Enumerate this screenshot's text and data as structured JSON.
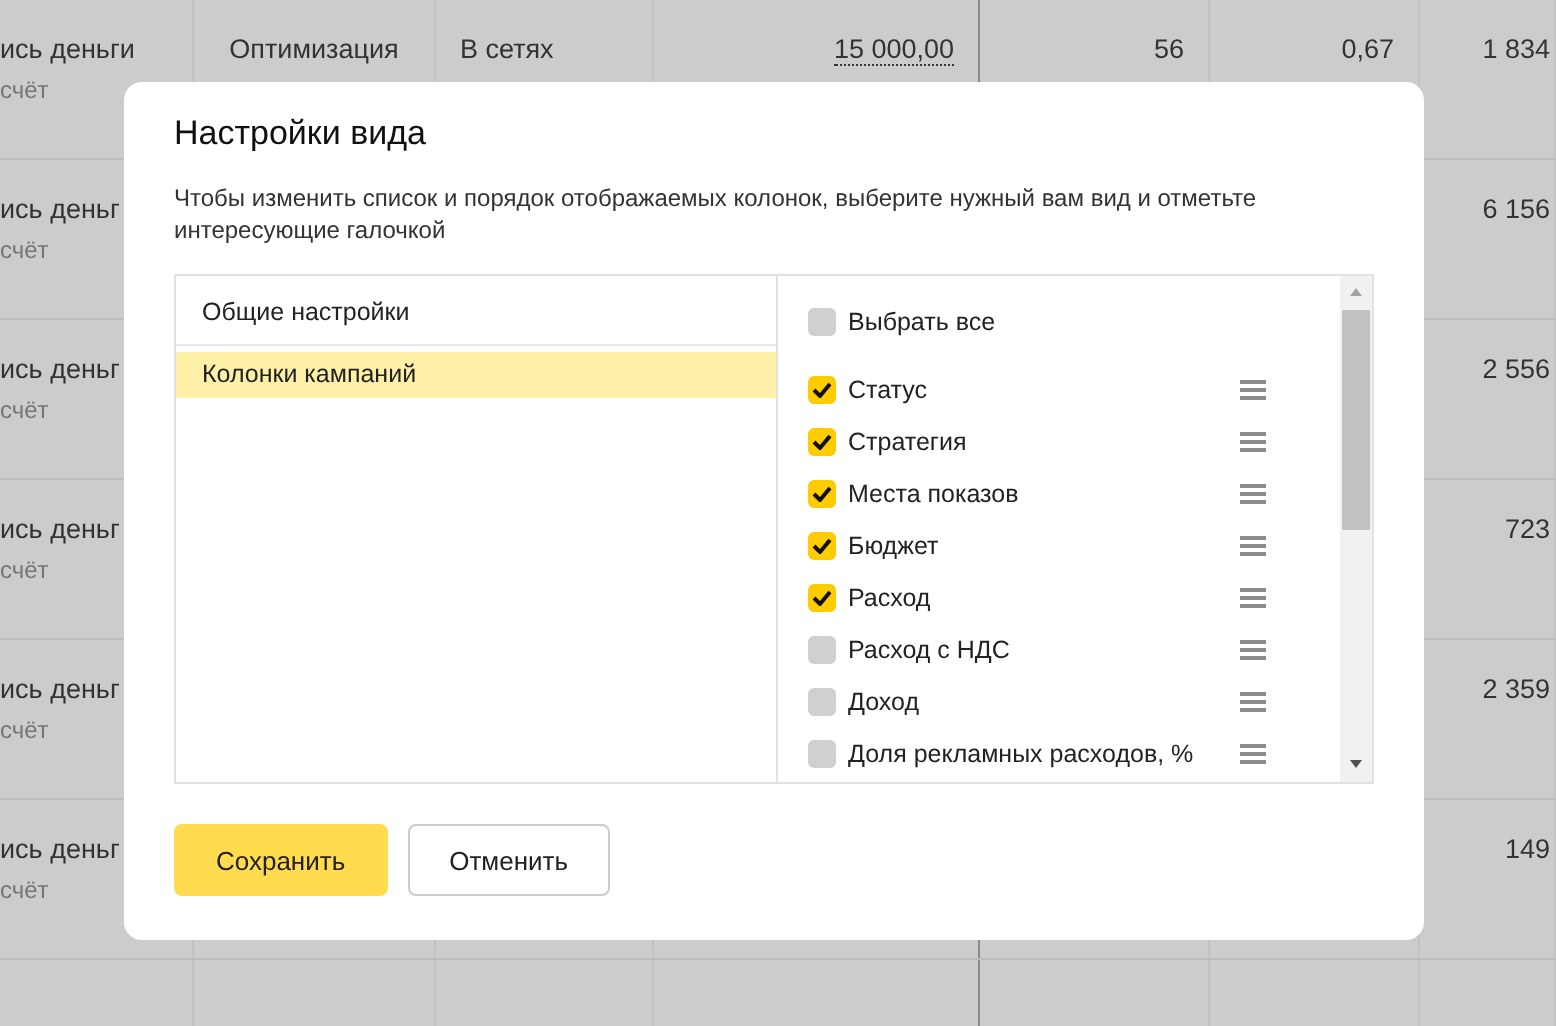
{
  "table": {
    "rows": [
      {
        "name": "ись деньги",
        "note": "счёт",
        "column_2": "Оптимизация",
        "column_3": "В сетях",
        "column_4": "15 000,00",
        "column_5": "56",
        "column_6": "0,67",
        "column_7": "1 834"
      },
      {
        "name": "ись деньг",
        "note": "счёт",
        "column_7": "6 156"
      },
      {
        "name": "ись деньг",
        "note": "счёт",
        "column_7": "2 556"
      },
      {
        "name": "ись деньг",
        "note": "счёт",
        "column_7": "723"
      },
      {
        "name": "ись деньг",
        "note": "счёт",
        "column_7": "2 359"
      },
      {
        "name": "ись деньг",
        "note": "счёт",
        "column_7": "149"
      }
    ]
  },
  "dialog": {
    "title": "Настройки вида",
    "description": "Чтобы изменить список и порядок отображаемых колонок, выберите нужный вам вид и отметьте интересующие галочкой",
    "sections": [
      {
        "label": "Общие настройки",
        "selected": false
      },
      {
        "label": "Колонки кампаний",
        "selected": true
      }
    ],
    "select_all": {
      "label": "Выбрать все",
      "checked": false
    },
    "columns": [
      {
        "label": "Статус",
        "checked": true
      },
      {
        "label": "Стратегия",
        "checked": true
      },
      {
        "label": "Места показов",
        "checked": true
      },
      {
        "label": "Бюджет",
        "checked": true
      },
      {
        "label": "Расход",
        "checked": true
      },
      {
        "label": "Расход с НДС",
        "checked": false
      },
      {
        "label": "Доход",
        "checked": false
      },
      {
        "label": "Доля рекламных расходов, %",
        "checked": false
      }
    ],
    "buttons": [
      {
        "label": "Сохранить",
        "kind": "primary"
      },
      {
        "label": "Отменить",
        "kind": "secondary"
      }
    ]
  }
}
